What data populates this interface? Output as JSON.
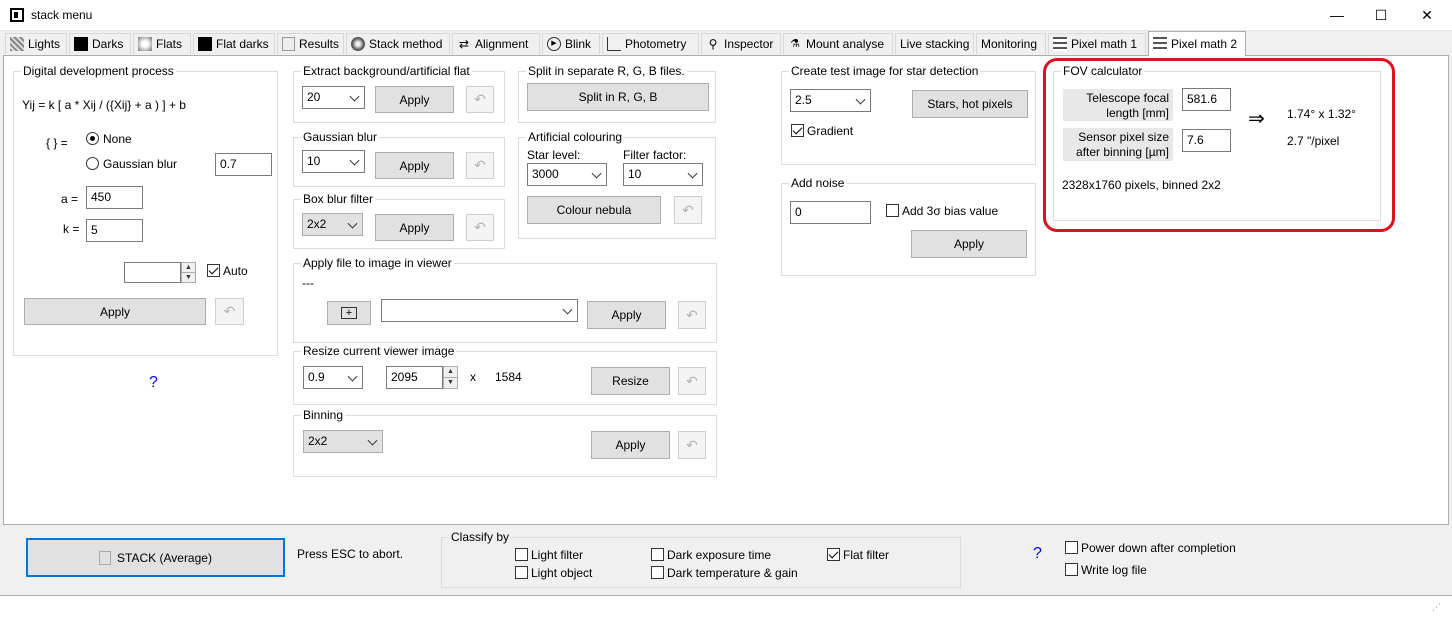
{
  "window": {
    "title": "stack menu",
    "minimize": "—",
    "maximize": "☐",
    "close": "✕"
  },
  "tabs": [
    "Lights",
    "Darks",
    "Flats",
    "Flat darks",
    "Results",
    "Stack method",
    "Alignment",
    "Blink",
    "Photometry",
    "Inspector",
    "Mount analyse",
    "Live stacking",
    "Monitoring",
    "Pixel math 1",
    "Pixel math 2"
  ],
  "digital": {
    "title": "Digital development process",
    "formula": "Yij = k [ a * Xij / ({Xij} + a ) ] + b",
    "braces_label": "{ } =",
    "none_label": "None",
    "gaussian_label": "Gaussian blur",
    "gaussian_value": "0.7",
    "a_label": "a =",
    "a_value": "450",
    "k_label": "k =",
    "k_value": "5",
    "spin_value": "",
    "auto_label": "Auto",
    "apply": "Apply",
    "undo": "↶",
    "help": "?"
  },
  "extract": {
    "title": "Extract background/artificial flat",
    "value": "20",
    "apply": "Apply"
  },
  "gaussian": {
    "title": "Gaussian blur",
    "value": "10",
    "apply": "Apply"
  },
  "boxblur": {
    "title": "Box blur filter",
    "value": "2x2",
    "apply": "Apply"
  },
  "split": {
    "title": "Split in separate R, G, B files.",
    "button": "Split in R, G, B"
  },
  "artificial": {
    "title": "Artificial colouring",
    "star_label": "Star level:",
    "star_value": "3000",
    "filter_label": "Filter factor:",
    "filter_value": "10",
    "button": "Colour nebula"
  },
  "applyfile": {
    "title": "Apply file to image in viewer",
    "placeholder": "---",
    "combo_value": "",
    "apply": "Apply"
  },
  "resize": {
    "title": "Resize current viewer image",
    "factor": "0.9",
    "width": "2095",
    "x_label": "x",
    "height": "1584",
    "button": "Resize"
  },
  "binning": {
    "title": "Binning",
    "value": "2x2",
    "apply": "Apply"
  },
  "testimage": {
    "title": "Create test image for star detection",
    "value": "2.5",
    "button": "Stars, hot pixels",
    "gradient_label": "Gradient"
  },
  "noise": {
    "title": "Add noise",
    "value": "0",
    "bias_label": "Add 3σ bias value",
    "apply": "Apply"
  },
  "fov": {
    "title": "FOV calculator",
    "focal_label": "Telescope focal length [mm]",
    "focal_value": "581.6",
    "pixel_label": "Sensor pixel size after binning [µm]",
    "pixel_value": "7.6",
    "arrow": "⇒",
    "fov_result": "1.74° x 1.32°",
    "scale_result": "2.7 \"/pixel",
    "pixels_info": "2328x1760 pixels, binned 2x2"
  },
  "bottom": {
    "stack_button": "STACK  (Average)",
    "esc_text": "Press ESC to abort.",
    "classify_title": "Classify by",
    "light_filter": "Light filter",
    "light_object": "Light object",
    "dark_exposure": "Dark exposure time",
    "dark_temp": "Dark temperature & gain",
    "flat_filter": "Flat filter",
    "help": "?",
    "power_down": "Power down after completion",
    "write_log": "Write log file"
  },
  "status": {
    "text": ""
  },
  "colors": {
    "highlight": "#e0101e",
    "accent": "#0078d7",
    "help": "#0000ff"
  }
}
